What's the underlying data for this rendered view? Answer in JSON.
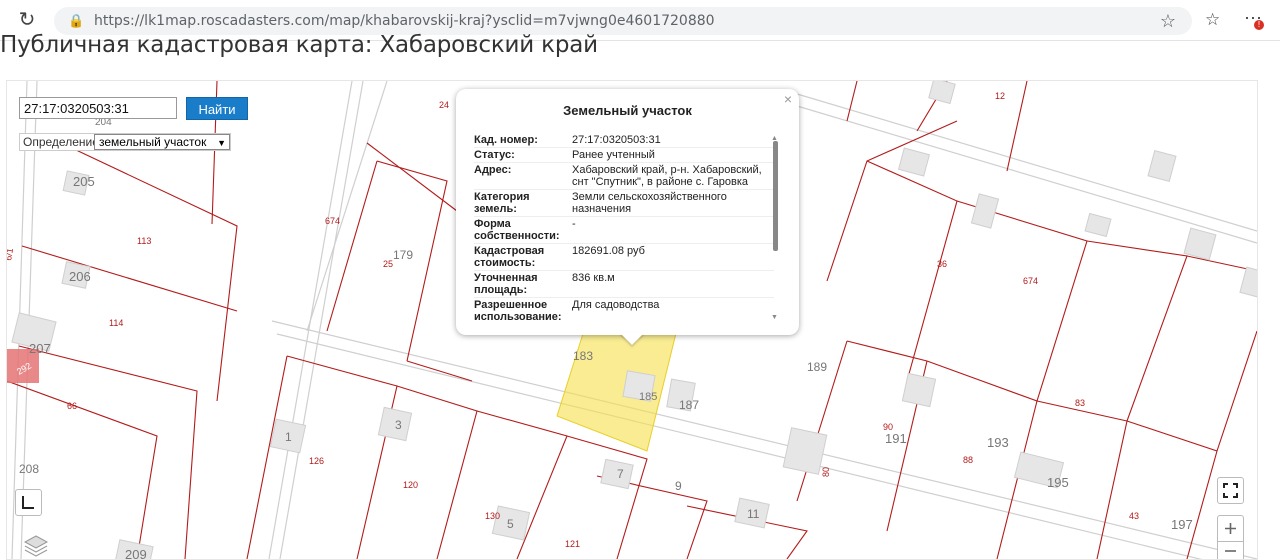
{
  "browser": {
    "url": "https://lk1map.roscadasters.com/map/khabarovskij-kraj?ysclid=m7vjwng0e4601720880",
    "reload_icon": "reload-icon",
    "lock_icon": "lock-icon",
    "star_icon": "star-icon",
    "menu_badge": "!"
  },
  "page": {
    "title": "Публичная кадастровая карта: Хабаровский край"
  },
  "search": {
    "value": "27:17:0320503:31",
    "button": "Найти",
    "definition_label": "Определение:",
    "definition_value": "земельный участок"
  },
  "popup": {
    "title": "Земельный участок",
    "close": "×",
    "rows": [
      {
        "label": "Кад. номер:",
        "value": "27:17:0320503:31"
      },
      {
        "label": "Статус:",
        "value": "Ранее учтенный"
      },
      {
        "label": "Адрес:",
        "value": "Хабаровский край, р-н. Хабаровский, снт \"Спутник\", в районе с. Гаровка"
      },
      {
        "label": "Категория земель:",
        "value": "Земли сельскохозяйственного назначения"
      },
      {
        "label": "Форма собственности:",
        "value": "-"
      },
      {
        "label": "Кадастровая стоимость:",
        "value": "182691.08 руб"
      },
      {
        "label": "Уточненная площадь:",
        "value": "836 кв.м"
      },
      {
        "label": "Разрешенное использование:",
        "value": "Для садоводства"
      }
    ]
  },
  "colors": {
    "parcel_line": "#b31b1b",
    "road_line": "#c8c8c8",
    "highlight": "#f5e04a",
    "button": "#1a7dc9"
  },
  "map_labels": {
    "grey": [
      "204",
      "205",
      "206",
      "207",
      "208",
      "209",
      "179",
      "183",
      "185",
      "187",
      "189",
      "191",
      "193",
      "195",
      "197",
      "1",
      "3",
      "5",
      "7",
      "9",
      "11"
    ],
    "red": [
      "24",
      "12",
      "674",
      "113",
      "114",
      "66",
      "25",
      "36",
      "674",
      "83",
      "126",
      "120",
      "130",
      "121",
      "88",
      "43",
      "90",
      "80",
      "292",
      "6/1"
    ]
  }
}
